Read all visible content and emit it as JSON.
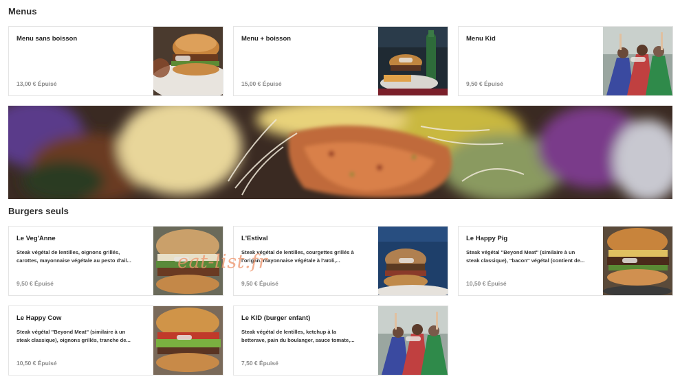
{
  "sections": {
    "menus": {
      "title": "Menus"
    },
    "burgers": {
      "title": "Burgers seuls"
    }
  },
  "menus": [
    {
      "name": "Menu sans boisson",
      "price": "13,00 € Épuisé",
      "image": "burger-plate-photo"
    },
    {
      "name": "Menu + boisson",
      "price": "15,00 € Épuisé",
      "image": "burger-fries-drink-photo"
    },
    {
      "name": "Menu Kid",
      "price": "9,50 € Épuisé",
      "image": "kids-superheroes-photo"
    }
  ],
  "burgers": [
    {
      "name": "Le Veg'Anne",
      "desc_line1": "Steak végétal de lentilles, oignons grillés,",
      "desc_line2": "carottes, mayonnaise végétale au pesto d'ail...",
      "price": "9,50 € Épuisé",
      "image": "burger-photo"
    },
    {
      "name": "L'Estival",
      "desc_line1": "Steak végétal de lentilles, courgettes grillés à",
      "desc_line2": "l'origan, mayonnaise végétale à l'aïoli,...",
      "price": "9,50 € Épuisé",
      "image": "burger-chic-sign-photo"
    },
    {
      "name": "Le Happy Pig",
      "desc_line1": "Steak végétal \"Beyond Meat\" (similaire à un",
      "desc_line2": "steak classique), \"bacon\" végétal (contient de...",
      "price": "10,50 € Épuisé",
      "image": "burger-closeup-photo"
    },
    {
      "name": "Le Happy Cow",
      "desc_line1": "Steak végétal \"Beyond Meat\" (similaire à un",
      "desc_line2": "steak classique), oignons grillés, tranche de...",
      "price": "10,50 € Épuisé",
      "image": "burger-lettuce-photo"
    },
    {
      "name": "Le KID (burger enfant)",
      "desc_line1": "Steak végétal de lentilles, ketchup à la",
      "desc_line2": "betterave, pain du boulanger, sauce tomate,...",
      "price": "7,50 € Épuisé",
      "image": "kids-superheroes-photo"
    }
  ],
  "banner": {
    "image": "veggie-patty-closeup-photo"
  },
  "watermark": "eat-list.fr",
  "colors": {
    "price_text": "#8a8a8a",
    "card_border": "#e4e4e4",
    "watermark": "#ee966e"
  }
}
